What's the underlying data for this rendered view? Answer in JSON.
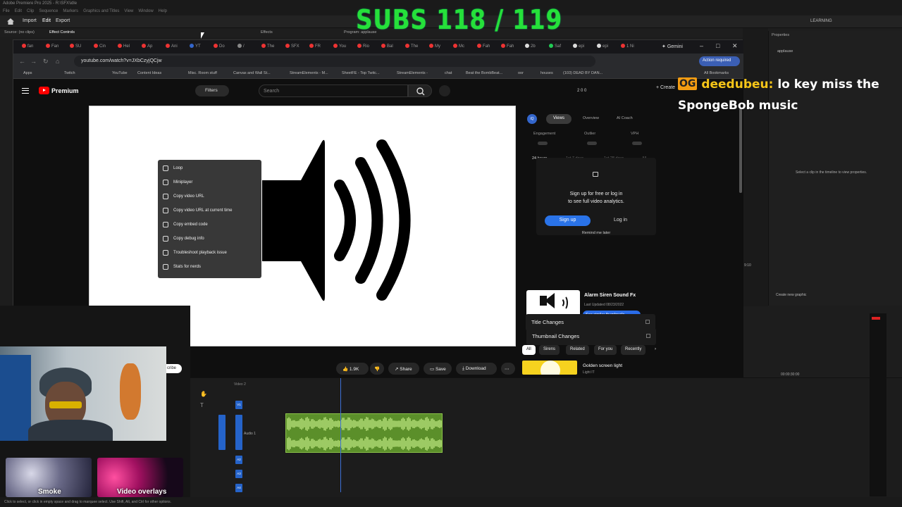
{
  "premiere": {
    "title_bar": "Adobe Premiere Pro 2025 - R:\\SFX\\idle",
    "menu": [
      "File",
      "Edit",
      "Clip",
      "Sequence",
      "Markers",
      "Graphics and Titles",
      "View",
      "Window",
      "Help"
    ],
    "top_tabs": [
      "Import",
      "Edit",
      "Export"
    ],
    "learning": "LEARNING",
    "panel_tabs": {
      "source": "Source: (no clips)",
      "effect_controls": "Effect Controls",
      "effects": "Effects",
      "program": "Program: applause",
      "properties": "Properties"
    },
    "properties": {
      "name": "applause",
      "hint": "Select a clip in the timeline to view properties.",
      "create_graphic": "Create new graphic"
    },
    "timecode_small": "9:10",
    "timeline_timecode": "00:00:30:00",
    "tracks": {
      "v2": "Video 2",
      "v1": "V1",
      "a1": "Audio 1",
      "a2": "A2",
      "a3": "A3",
      "a4": "A4"
    },
    "status": "Click to select, or click in empty space and drag to marquee select. Use Shift, Alt, and Ctrl for other options.",
    "effects_thumbs": {
      "smoke": "Smoke",
      "video_overlays": "Video overlays"
    },
    "subscribe_fragment": "cribe"
  },
  "overlay": {
    "subs": "SUBS 118 / 119",
    "chat_badge": "OG",
    "chat_user": "deedubeu:",
    "chat_text": "lo key miss the SpongeBob music"
  },
  "browser": {
    "tabs": [
      "fan",
      "Fan",
      "SU",
      "Cin",
      "Hel",
      "Ap",
      "Ani",
      "YT",
      "Do",
      "/",
      "The",
      "SFX",
      "FR",
      "You",
      "Rio",
      "Bal",
      "The",
      "My",
      "Mc",
      "Fah",
      "Fah",
      "2b",
      "Saf",
      "epi",
      "epi",
      "1 Ni"
    ],
    "gemini": "Gemini",
    "url": "youtube.com/watch?v=JXbCzyjQCjw",
    "action_required": "Action required",
    "bookmarks": [
      "Apps",
      "Twitch",
      "YouTube",
      "Content Ideas",
      "Misc. Room stuff",
      "Canvas and Wall St...",
      "StreamElements - M...",
      "SheetFE - Top Twitc...",
      "StreamElements -",
      "chat",
      "Beat the BombBeat...",
      "oor",
      "houses",
      "(103) DEAD BY DAN...",
      "All Bookmarks"
    ]
  },
  "youtube": {
    "brand": "Premium",
    "filters": "Filters",
    "search_placeholder": "Search",
    "header_stats": "2   0   0",
    "create": "Create",
    "context_menu": [
      "Loop",
      "Miniplayer",
      "Copy video URL",
      "Copy video URL at current time",
      "Copy embed code",
      "Copy debug info",
      "Troubleshoot playback issue",
      "Stats for nerds"
    ],
    "actions": {
      "likes": "1.9K",
      "share": "Share",
      "save": "Save",
      "download": "Download"
    },
    "vidiq": {
      "iq": "iQ",
      "tabs": [
        "Views",
        "Overview",
        "AI Coach"
      ],
      "metrics": [
        "Engagement",
        "Outlier",
        "VPH"
      ],
      "ranges": [
        "24 hours",
        "1st 7 days",
        "1st 28 days",
        "All"
      ],
      "signup_msg_line1": "Sign up for free or log in",
      "signup_msg_line2": "to see full video analytics.",
      "signup": "Sign up",
      "login": "Log in",
      "remind": "Remind me later"
    },
    "current_video": {
      "title": "Alarm Siren Sound Fx",
      "date": "Last Updated 08/23/2022",
      "similar": "See similar thumbnails"
    },
    "lock_rows": [
      "Thumbnail Changes",
      "Title Changes"
    ],
    "chips": [
      "All",
      "Sirens",
      "Related",
      "For you",
      "Recently"
    ],
    "rec": {
      "title": "Golden screen light",
      "channel": "Light IT"
    }
  }
}
